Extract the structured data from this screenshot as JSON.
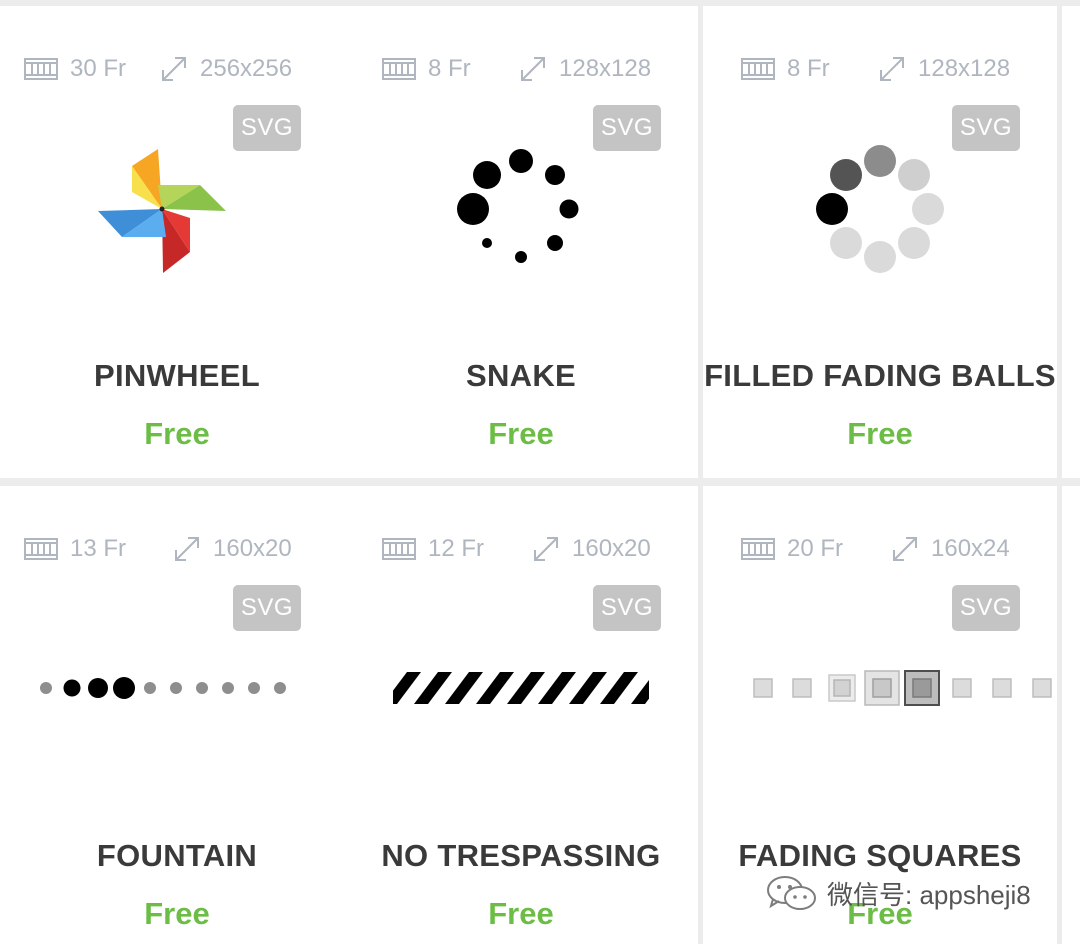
{
  "cards": [
    {
      "frames": "30 Fr",
      "size": "256x256",
      "badge": "SVG",
      "title": "PINWHEEL",
      "price": "Free"
    },
    {
      "frames": "8 Fr",
      "size": "128x128",
      "badge": "SVG",
      "title": "SNAKE",
      "price": "Free"
    },
    {
      "frames": "8 Fr",
      "size": "128x128",
      "badge": "SVG",
      "title": "FILLED FADING BALLS",
      "price": "Free"
    },
    {
      "frames": "13 Fr",
      "size": "160x20",
      "badge": "SVG",
      "title": "FOUNTAIN",
      "price": "Free"
    },
    {
      "frames": "12 Fr",
      "size": "160x20",
      "badge": "SVG",
      "title": "NO TRESPASSING",
      "price": "Free"
    },
    {
      "frames": "20 Fr",
      "size": "160x24",
      "badge": "SVG",
      "title": "FADING SQUARES",
      "price": "Free"
    }
  ],
  "icons": {
    "frames": "film-frames-icon",
    "size": "resize-arrow-icon"
  },
  "colors": {
    "price": "#6cbd45",
    "badge": "#c4c4c4",
    "meta": "#b0b6bf",
    "title": "#3a3a3a"
  },
  "watermark": {
    "text": "微信号: appsheji8"
  }
}
